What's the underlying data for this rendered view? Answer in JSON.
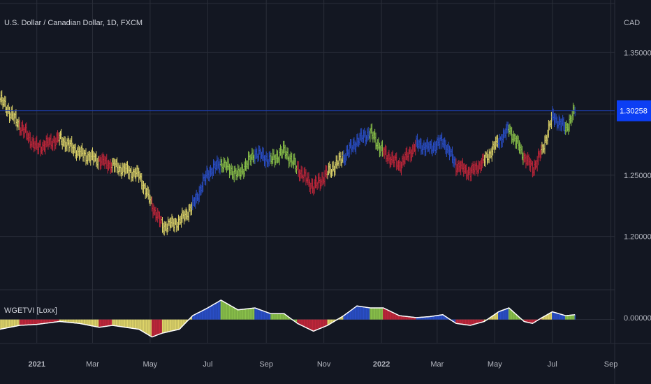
{
  "header": {
    "symbol_title": "U.S. Dollar / Canadian Dollar, 1D, FXCM",
    "currency": "CAD"
  },
  "indicator": {
    "name": "WGETVI [Loxx]",
    "zero_label": "0.00000"
  },
  "price_axis": {
    "tick_labels": [
      "1.35000",
      "1.30000",
      "1.25000",
      "1.20000"
    ],
    "tick_values": [
      1.35,
      1.3,
      1.25,
      1.2
    ],
    "current_price": "1.30258",
    "current_value": 1.30258,
    "ylim": [
      1.157,
      1.393
    ]
  },
  "time_axis": {
    "labels": [
      "2021",
      "Mar",
      "May",
      "Jul",
      "Sep",
      "Nov",
      "2022",
      "Mar",
      "May",
      "Jul",
      "Sep"
    ],
    "bold": [
      true,
      false,
      false,
      false,
      false,
      false,
      true,
      false,
      false,
      false,
      false
    ],
    "dates": [
      "2021-01-01",
      "2021-03-01",
      "2021-05-01",
      "2021-07-01",
      "2021-09-01",
      "2021-11-01",
      "2022-01-01",
      "2022-03-01",
      "2022-05-01",
      "2022-07-01",
      "2022-09-01"
    ],
    "range": [
      "2020-11-23",
      "2022-09-05"
    ]
  },
  "colors": {
    "background": "#131722",
    "grid": "#2a2e39",
    "text": "#b2b5be",
    "price_line": "#1e3fb4",
    "price_badge": "#0c3ef4",
    "bear_red": "#c2263a",
    "neutral_yellow": "#e0d66a",
    "bull_blue": "#2a4fc9",
    "bull_green": "#8bc34a",
    "signal_line": "#ffffff"
  },
  "chart_data": {
    "type": "bar",
    "price_series": {
      "name": "U.S. Dollar / Canadian Dollar, 1D, FXCM",
      "x": [
        "2020-11-23",
        "2020-12-14",
        "2021-01-01",
        "2021-01-25",
        "2021-02-15",
        "2021-03-08",
        "2021-03-22",
        "2021-04-19",
        "2021-05-03",
        "2021-05-14",
        "2021-06-01",
        "2021-06-15",
        "2021-07-01",
        "2021-07-15",
        "2021-08-02",
        "2021-08-20",
        "2021-09-06",
        "2021-09-20",
        "2021-10-04",
        "2021-10-21",
        "2021-11-05",
        "2021-11-22",
        "2021-12-06",
        "2021-12-20",
        "2022-01-03",
        "2022-01-20",
        "2022-02-07",
        "2022-02-21",
        "2022-03-07",
        "2022-03-21",
        "2022-04-05",
        "2022-04-20",
        "2022-05-05",
        "2022-05-16",
        "2022-06-01",
        "2022-06-10",
        "2022-06-20",
        "2022-07-01",
        "2022-07-15",
        "2022-07-25"
      ],
      "close": [
        1.312,
        1.29,
        1.272,
        1.28,
        1.268,
        1.262,
        1.258,
        1.25,
        1.225,
        1.208,
        1.212,
        1.225,
        1.252,
        1.26,
        1.25,
        1.268,
        1.262,
        1.27,
        1.255,
        1.24,
        1.252,
        1.265,
        1.278,
        1.285,
        1.268,
        1.258,
        1.275,
        1.272,
        1.278,
        1.258,
        1.252,
        1.262,
        1.278,
        1.288,
        1.265,
        1.255,
        1.27,
        1.298,
        1.288,
        1.303
      ],
      "state": [
        "yellow",
        "red",
        "red",
        "yellow",
        "yellow",
        "red",
        "yellow",
        "yellow",
        "red",
        "yellow",
        "yellow",
        "blue",
        "blue",
        "green",
        "green",
        "blue",
        "green",
        "green",
        "red",
        "red",
        "yellow",
        "blue",
        "blue",
        "green",
        "red",
        "red",
        "blue",
        "blue",
        "blue",
        "red",
        "red",
        "yellow",
        "blue",
        "green",
        "red",
        "red",
        "yellow",
        "blue",
        "green",
        "blue"
      ]
    },
    "indicator_series": {
      "name": "WGETVI [Loxx]",
      "x": [
        "2020-11-23",
        "2020-12-14",
        "2021-01-01",
        "2021-01-25",
        "2021-02-15",
        "2021-03-08",
        "2021-03-22",
        "2021-04-19",
        "2021-05-03",
        "2021-05-14",
        "2021-06-01",
        "2021-06-15",
        "2021-07-01",
        "2021-07-15",
        "2021-08-02",
        "2021-08-20",
        "2021-09-06",
        "2021-09-20",
        "2021-10-04",
        "2021-10-21",
        "2021-11-05",
        "2021-11-22",
        "2021-12-06",
        "2021-12-20",
        "2022-01-03",
        "2022-01-20",
        "2022-02-07",
        "2022-02-21",
        "2022-03-07",
        "2022-03-21",
        "2022-04-05",
        "2022-04-20",
        "2022-05-05",
        "2022-05-16",
        "2022-06-01",
        "2022-06-10",
        "2022-06-20",
        "2022-07-01",
        "2022-07-15",
        "2022-07-25"
      ],
      "values": [
        -0.01,
        -0.006,
        -0.005,
        -0.002,
        -0.004,
        -0.008,
        -0.006,
        -0.01,
        -0.018,
        -0.014,
        -0.01,
        0.004,
        0.012,
        0.02,
        0.01,
        0.012,
        0.006,
        0.006,
        -0.004,
        -0.012,
        -0.006,
        0.004,
        0.014,
        0.012,
        0.012,
        0.004,
        0.002,
        0.003,
        0.005,
        -0.004,
        -0.006,
        -0.002,
        0.008,
        0.012,
        -0.002,
        -0.004,
        0.002,
        0.008,
        0.004,
        0.005
      ],
      "ylim": [
        -0.024,
        0.03
      ]
    }
  }
}
